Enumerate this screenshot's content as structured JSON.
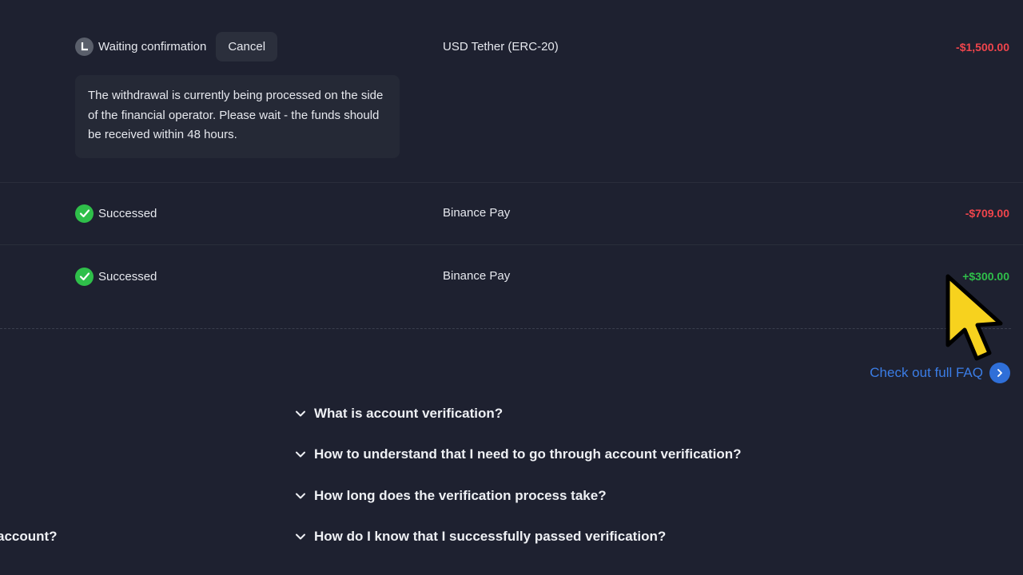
{
  "transactions": [
    {
      "status": "Waiting confirmation",
      "status_icon": "clock-icon",
      "cancel_label": "Cancel",
      "method": "USD Tether (ERC-20)",
      "amount": "-$1,500.00",
      "amount_color": "#f0454c"
    },
    {
      "status": "Successed",
      "status_icon": "check-circle-icon",
      "method": "Binance Pay",
      "amount": "-$709.00",
      "amount_color": "#f0454c"
    },
    {
      "status": "Successed",
      "status_icon": "check-circle-icon",
      "method": "Binance Pay",
      "amount": "+$300.00",
      "amount_color": "#2fbf4a"
    }
  ],
  "info_message": "The withdrawal is currently being processed on the side of the financial operator. Please wait - the funds should be received within 48 hours.",
  "faq": {
    "link_label": "Check out full FAQ",
    "questions": [
      "What is account verification?",
      "How to understand that I need to go through account verification?",
      "How long does the verification process take?",
      "How do I know that I successfully passed verification?"
    ],
    "left_partial": "account?"
  },
  "colors": {
    "background": "#1e2130",
    "negative": "#f0454c",
    "positive": "#2fbf4a",
    "link": "#3b7de6"
  }
}
